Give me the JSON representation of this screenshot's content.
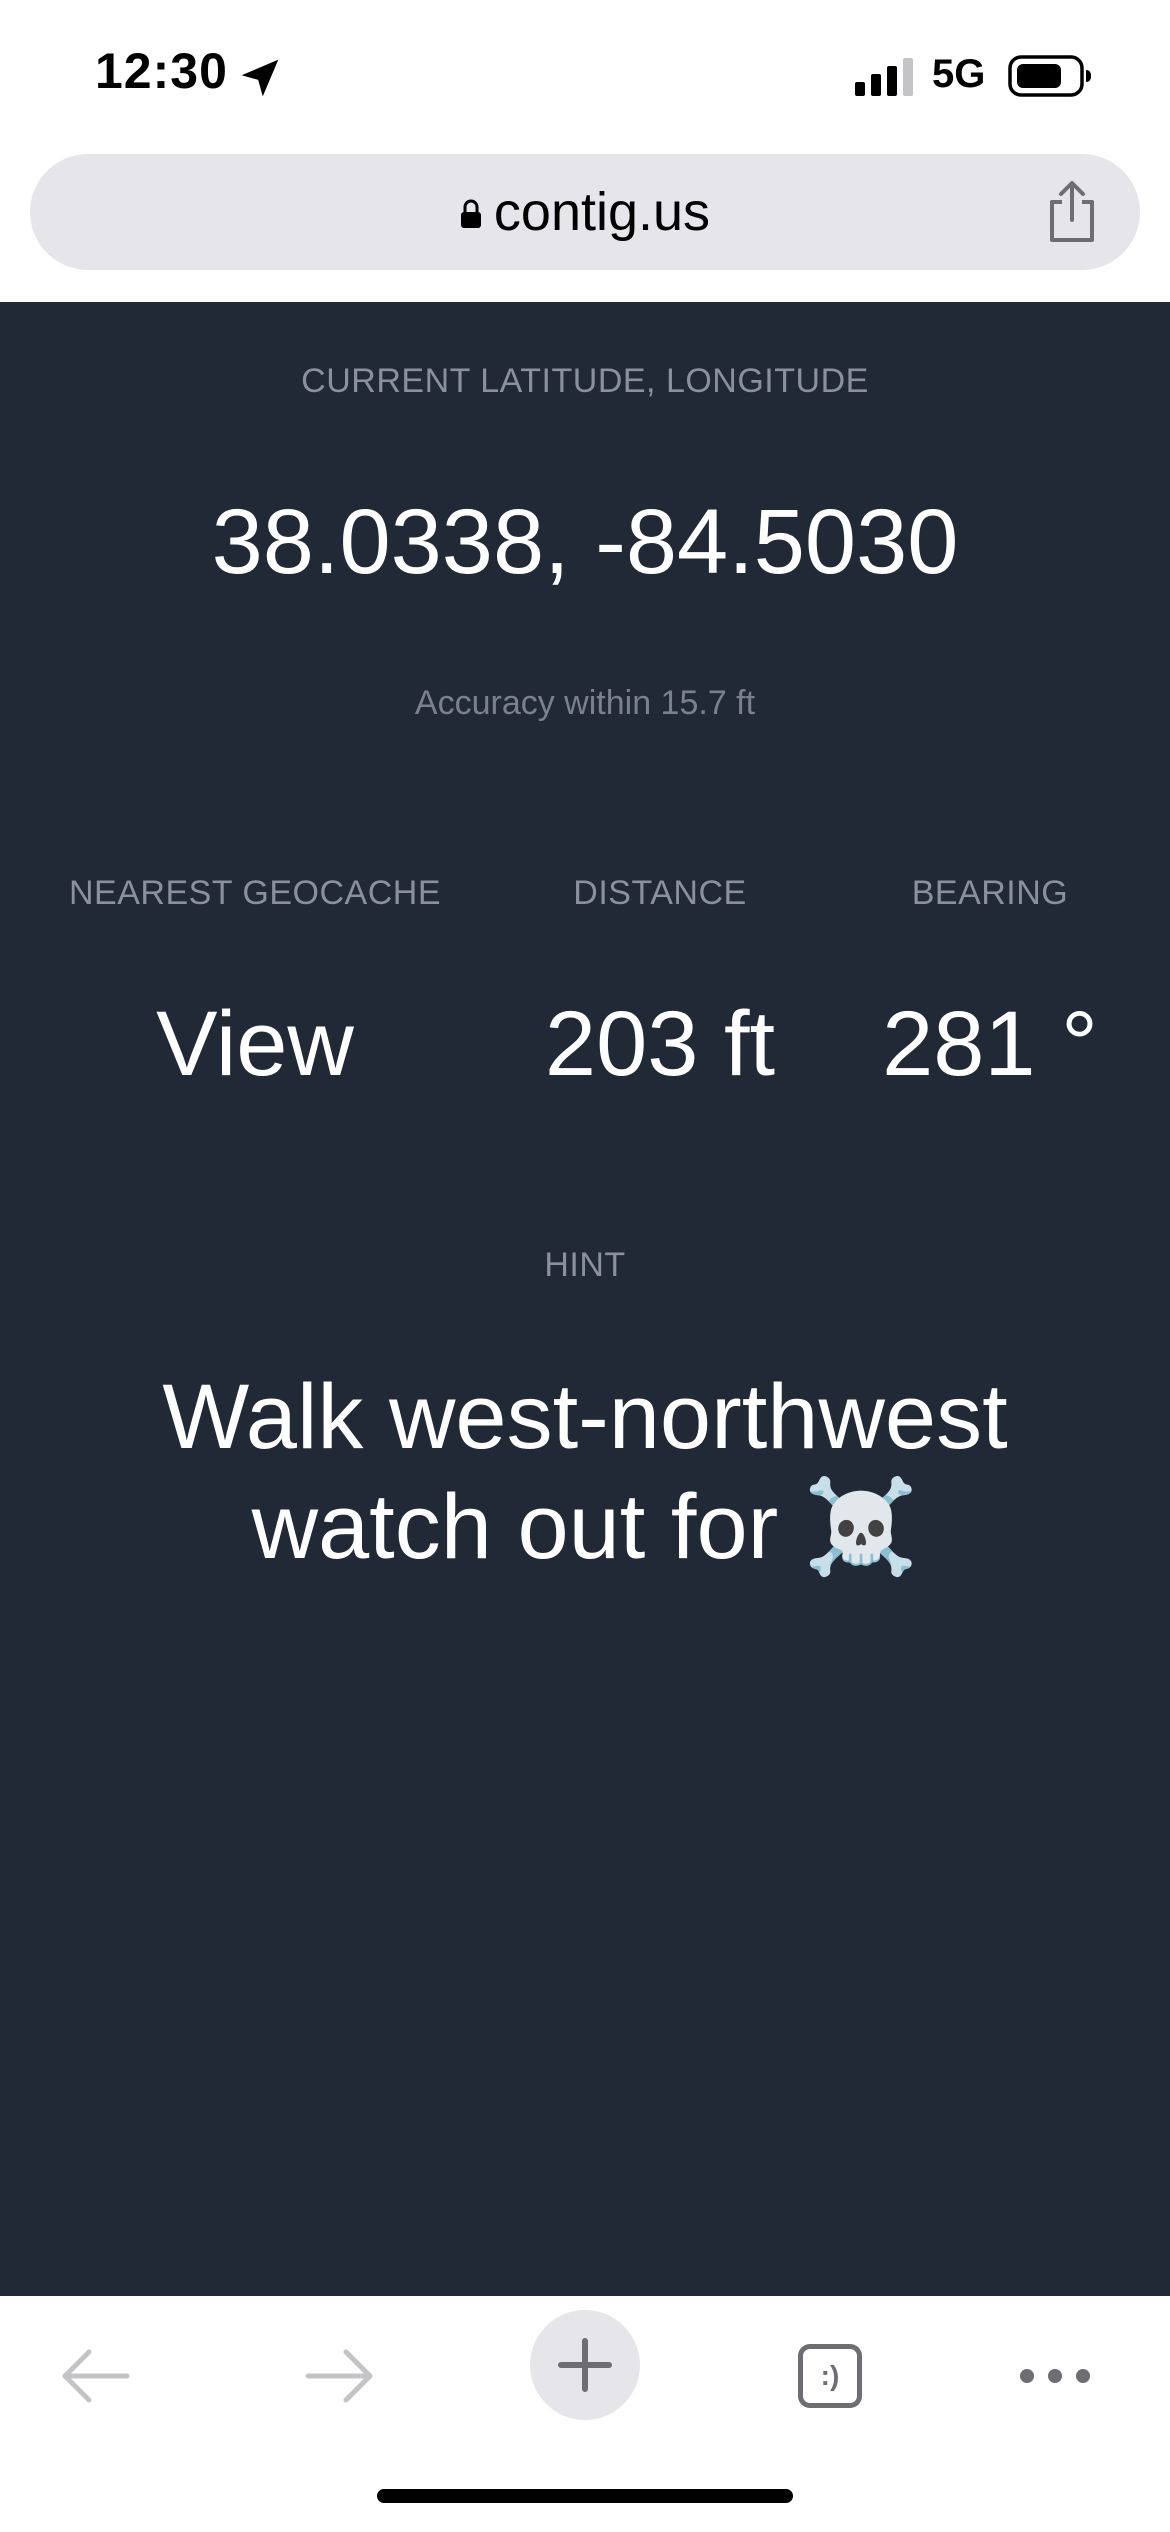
{
  "status_bar": {
    "time": "12:30",
    "network": "5G"
  },
  "browser": {
    "url": "contig.us"
  },
  "page": {
    "coord_label": "CURRENT LATITUDE, LONGITUDE",
    "coords": "38.0338, -84.5030",
    "accuracy": "Accuracy within 15.7 ft",
    "nearest_label": "NEAREST GEOCACHE",
    "nearest_value": "View",
    "distance_label": "DISTANCE",
    "distance_value": "203 ft",
    "bearing_label": "BEARING",
    "bearing_value": "281 °",
    "hint_label": "HINT",
    "hint_line1": "Walk west-northwest",
    "hint_line2": "watch out for ☠️"
  },
  "toolbar": {
    "tabs_label": ":)"
  },
  "colors": {
    "background": "#212937",
    "label": "#8a909c",
    "text": "#ffffff",
    "url_bar": "#e5e5ea"
  }
}
